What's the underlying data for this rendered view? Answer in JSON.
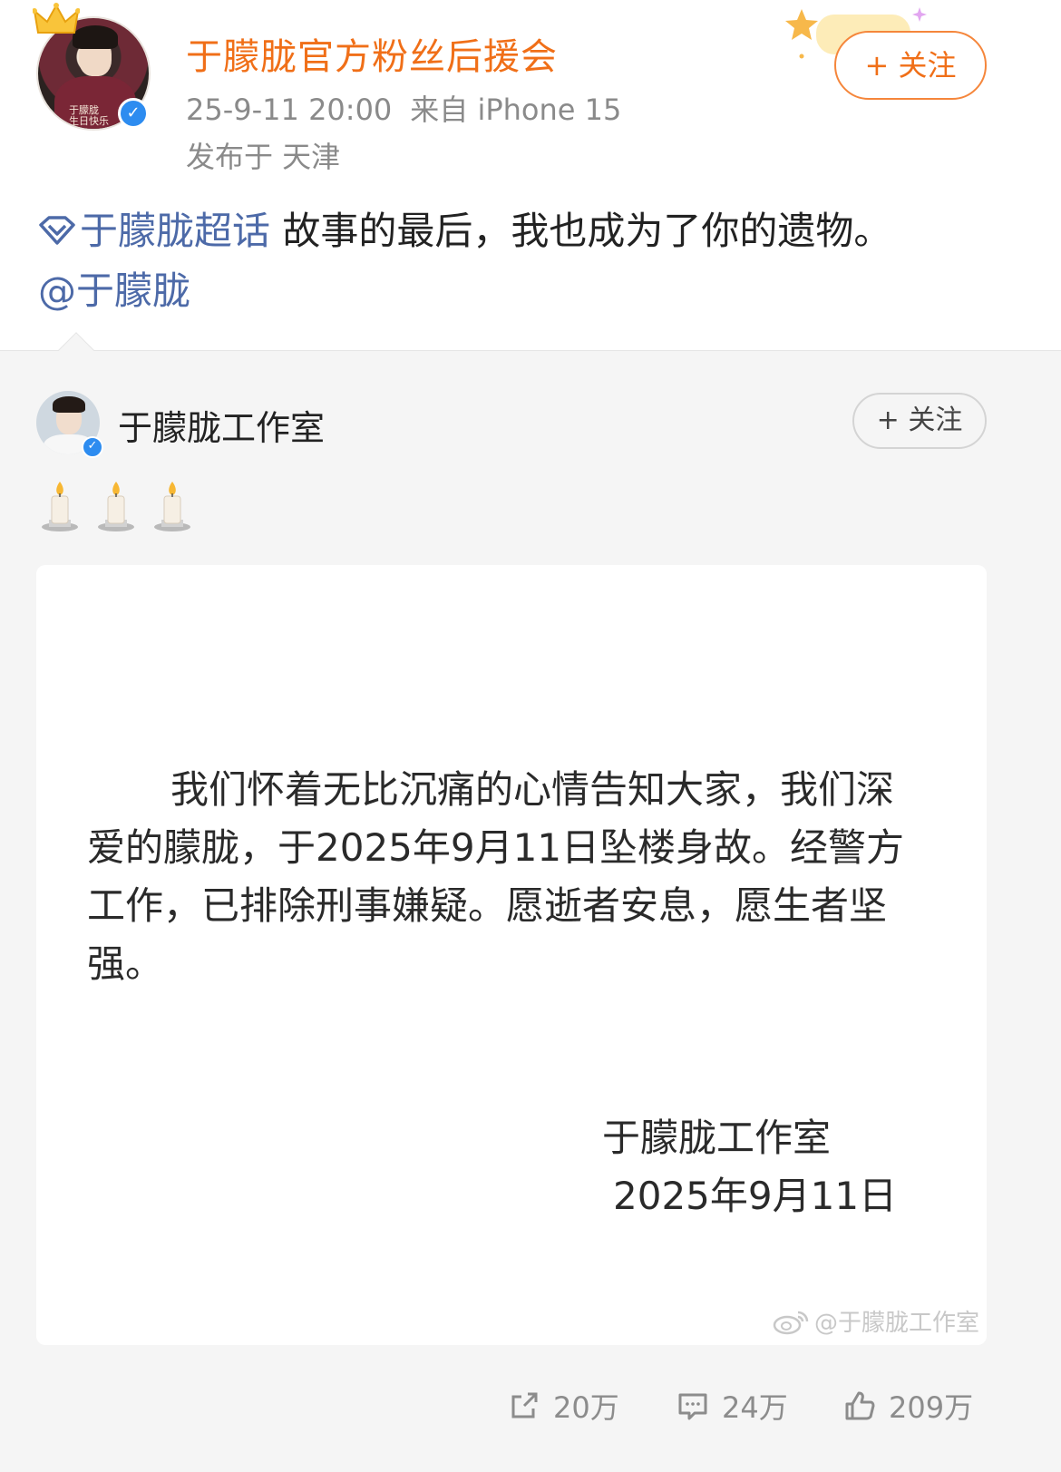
{
  "post": {
    "author": "于朦胧官方粉丝后援会",
    "time": "25-9-11 20:00",
    "source": "来自 iPhone 15",
    "location": "发布于  天津",
    "follow_label": "+ 关注",
    "topic": "于朦胧超话",
    "text": " 故事的最后，我也成为了你的遗物。",
    "mention": "@于朦胧"
  },
  "repost": {
    "author": "于朦胧工作室",
    "follow_label": "+ 关注",
    "statement": {
      "body": "我们怀着无比沉痛的心情告知大家，我们深爱的朦胧，于2025年9月11日坠楼身故。经警方工作，已排除刑事嫌疑。愿逝者安息，愿生者坚强。",
      "signature": "于朦胧工作室",
      "date": "2025年9月11日",
      "watermark": "@于朦胧工作室"
    },
    "actions": {
      "share": "20万",
      "comment": "24万",
      "like": "209万"
    }
  },
  "colors": {
    "author_orange": "#f06f18",
    "link_blue": "#4d6aa8",
    "verified_blue": "#2d8cf0",
    "meta_gray": "#8a8a8a"
  },
  "icons": [
    "crown-icon",
    "verified-icon",
    "topic-diamond-icon",
    "candle-icon",
    "weibo-logo-icon",
    "share-icon",
    "comment-icon",
    "like-icon"
  ]
}
